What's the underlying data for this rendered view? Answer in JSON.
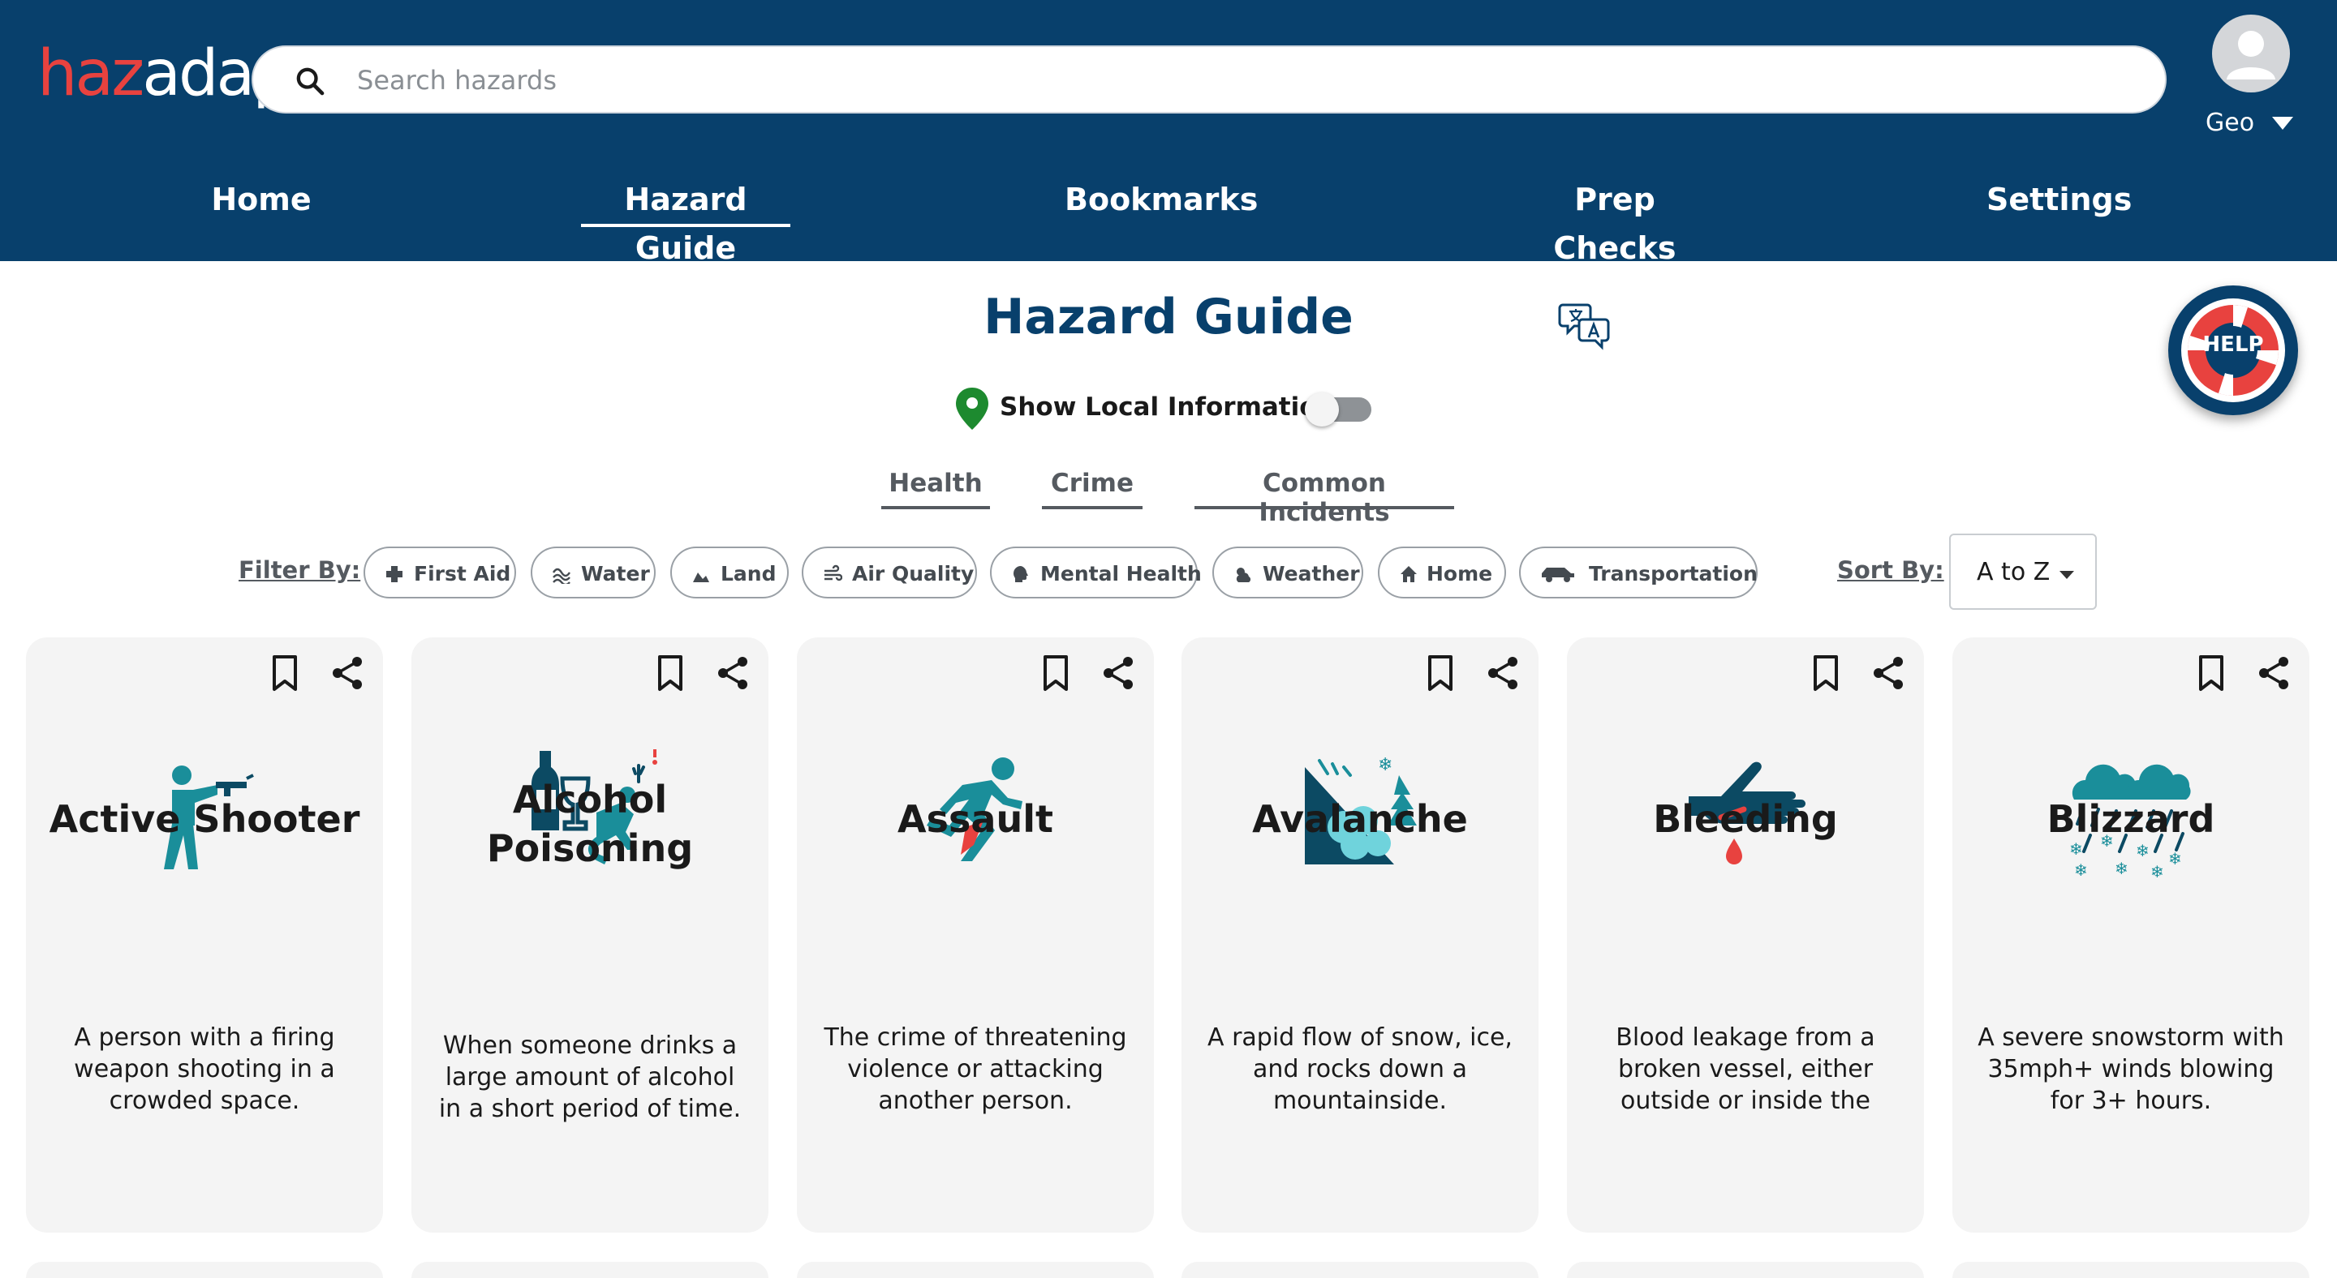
{
  "header": {
    "logo_a": "haz",
    "logo_b": "adapt",
    "search_placeholder": "Search hazards",
    "user_name": "Geo",
    "nav": [
      "Home",
      "Hazard Guide",
      "Bookmarks",
      "Prep Checks",
      "Settings"
    ],
    "active_nav": "Hazard Guide"
  },
  "page": {
    "title": "Hazard Guide",
    "local_info_label": "Show Local Information",
    "local_info_enabled": false,
    "help_label": "HELP",
    "categories": [
      "Health",
      "Crime",
      "Common Incidents"
    ]
  },
  "filters": {
    "label": "Filter By:",
    "chips": [
      "First Aid",
      "Water",
      "Land",
      "Air Quality",
      "Mental Health",
      "Weather",
      "Home",
      "Transportation"
    ],
    "sort_label": "Sort By:",
    "sort_value": "A to Z"
  },
  "cards": [
    {
      "title": "Active Shooter",
      "description": "A person with a firing weapon shooting in a crowded space.",
      "icon": "shooter-icon"
    },
    {
      "title": "Alcohol Poisoning",
      "description": "When someone drinks a large amount of alcohol in a short period of time.",
      "icon": "alcohol-icon"
    },
    {
      "title": "Assault",
      "description": "The crime of threatening violence or attacking another person.",
      "icon": "assault-icon"
    },
    {
      "title": "Avalanche",
      "description": "A rapid flow of snow, ice, and rocks down a mountainside.",
      "icon": "avalanche-icon"
    },
    {
      "title": "Bleeding",
      "description": "Blood leakage from a broken vessel, either outside or inside the",
      "icon": "bleeding-icon"
    },
    {
      "title": "Blizzard",
      "description": "A severe snowstorm with 35mph+ winds blowing for 3+ hours.",
      "icon": "blizzard-icon"
    }
  ],
  "colors": {
    "header_bg": "#08406c",
    "accent_teal": "#1a8e9a",
    "accent_red": "#e8423f",
    "card_bg": "#f4f4f4"
  }
}
